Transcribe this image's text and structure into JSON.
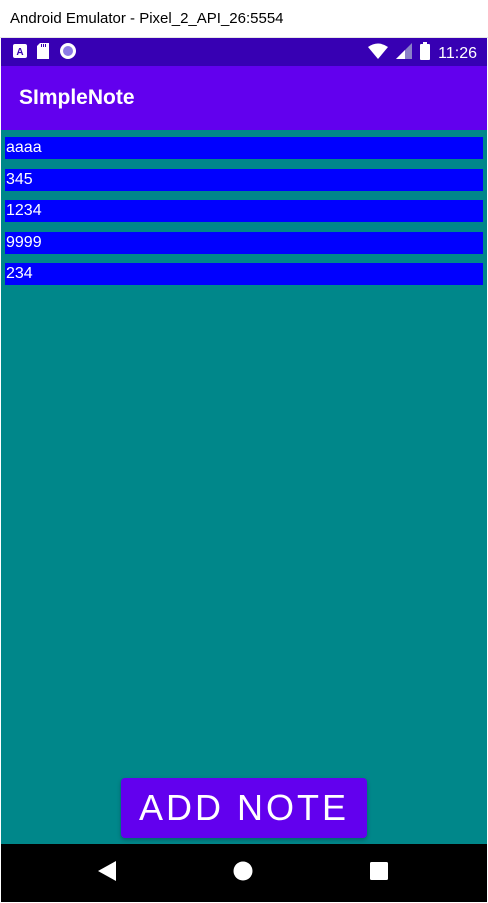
{
  "window": {
    "title": "Android Emulator - Pixel_2_API_26:5554"
  },
  "status_bar": {
    "left_icons": [
      "a-app-icon",
      "sd-card-icon",
      "circle-record-icon"
    ],
    "right_icons": [
      "wifi-icon",
      "signal-icon",
      "battery-icon"
    ],
    "time": "11:26"
  },
  "app_bar": {
    "title": "SImpleNote"
  },
  "notes": [
    "aaaa",
    "345",
    "1234",
    "9999",
    "234"
  ],
  "add_button": {
    "label": "ADD NOTE"
  },
  "nav_bar": {
    "buttons": [
      "back-icon",
      "home-icon",
      "recents-icon"
    ]
  },
  "colors": {
    "status_bar": "#3700b3",
    "app_bar": "#6200ee",
    "background": "#00878a",
    "note_item": "#0000ff",
    "button": "#6200ee"
  }
}
